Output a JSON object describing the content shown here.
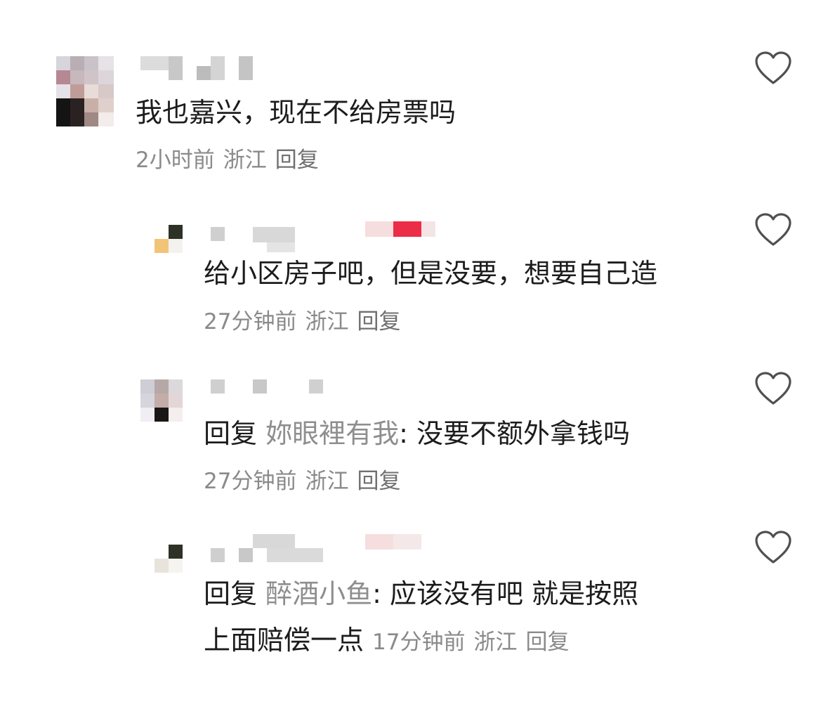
{
  "comments": [
    {
      "content": "我也嘉兴，现在不给房票吗",
      "time": "2小时前",
      "location": "浙江",
      "reply_label": "回复"
    },
    {
      "content": "给小区房子吧，但是没要，想要自己造",
      "time": "27分钟前",
      "location": "浙江",
      "reply_label": "回复"
    },
    {
      "reply_prefix": "回复",
      "mention": "妳眼裡有我",
      "content": ": 没要不额外拿钱吗",
      "time": "27分钟前",
      "location": "浙江",
      "reply_label": "回复"
    },
    {
      "reply_prefix": "回复",
      "mention": "醉酒小鱼",
      "content_line1": ": 应该没有吧 就是按照",
      "content_line2": "上面赔偿一点",
      "time": "17分钟前",
      "location": "浙江",
      "reply_label": "回复"
    }
  ],
  "colors": {
    "text": "#1c1c1c",
    "meta": "#8a8a8a",
    "mention": "#8e8e8e",
    "like_icon": "#505050"
  },
  "icons": {
    "like": "heart-outline-icon"
  }
}
